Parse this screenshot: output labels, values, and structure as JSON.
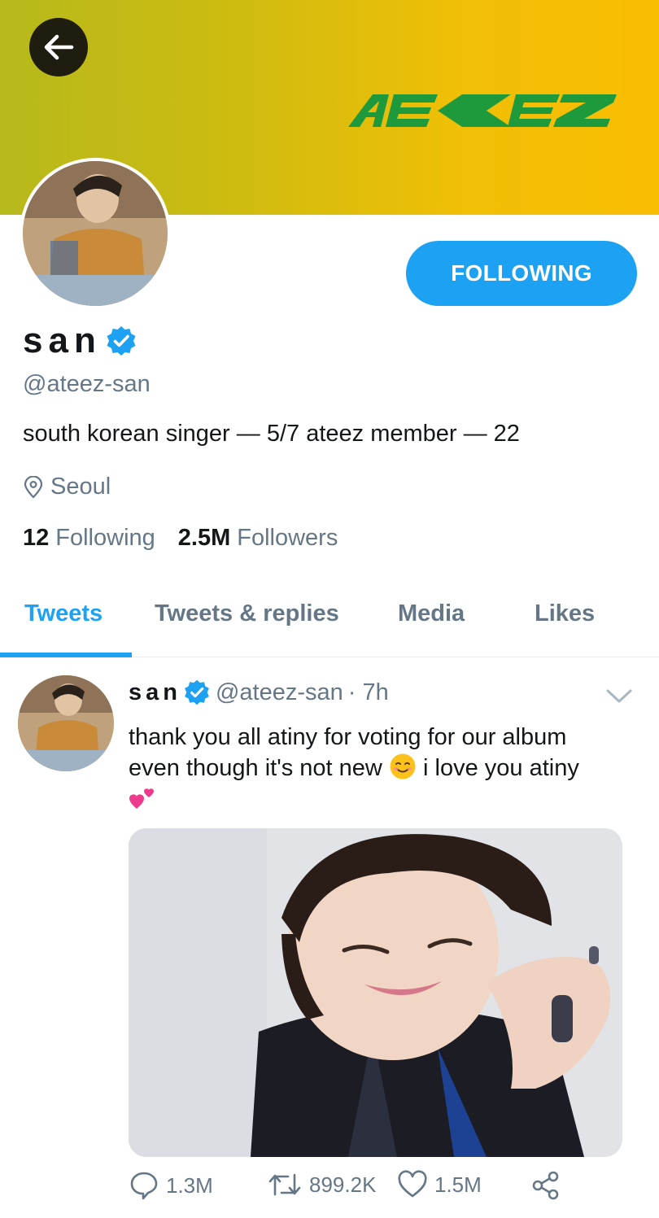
{
  "banner": {
    "logo_text": "ATEEZ"
  },
  "profile": {
    "name": "san",
    "handle": "@ateez-san",
    "bio": "south korean singer — 5/7 ateez member — 22",
    "location": "Seoul",
    "following_count": "12",
    "following_label": "Following",
    "followers_count": "2.5M",
    "followers_label": "Followers",
    "follow_button": "FOLLOWING"
  },
  "tabs": [
    {
      "label": "Tweets",
      "active": true
    },
    {
      "label": "Tweets & replies",
      "active": false
    },
    {
      "label": "Media",
      "active": false
    },
    {
      "label": "Likes",
      "active": false
    }
  ],
  "tweet": {
    "name": "san",
    "handle": "@ateez-san",
    "time": "· 7h",
    "text_line1": "thank you all atiny for voting for our album",
    "text_line2_a": "even though it's not new",
    "text_line2_b": "i love you atiny",
    "replies": "1.3M",
    "retweets": "899.2K",
    "likes": "1.5M"
  },
  "icons": [
    "back-arrow-icon",
    "verified-icon",
    "location-pin-icon",
    "chevron-down-icon",
    "reply-icon",
    "retweet-icon",
    "like-icon",
    "share-icon",
    "smiling-emoji-icon",
    "hearts-emoji-icon"
  ],
  "colors": {
    "accent": "#1da1f2",
    "muted": "#657786",
    "text": "#14171a",
    "logo_green": "#1e9a3c"
  }
}
